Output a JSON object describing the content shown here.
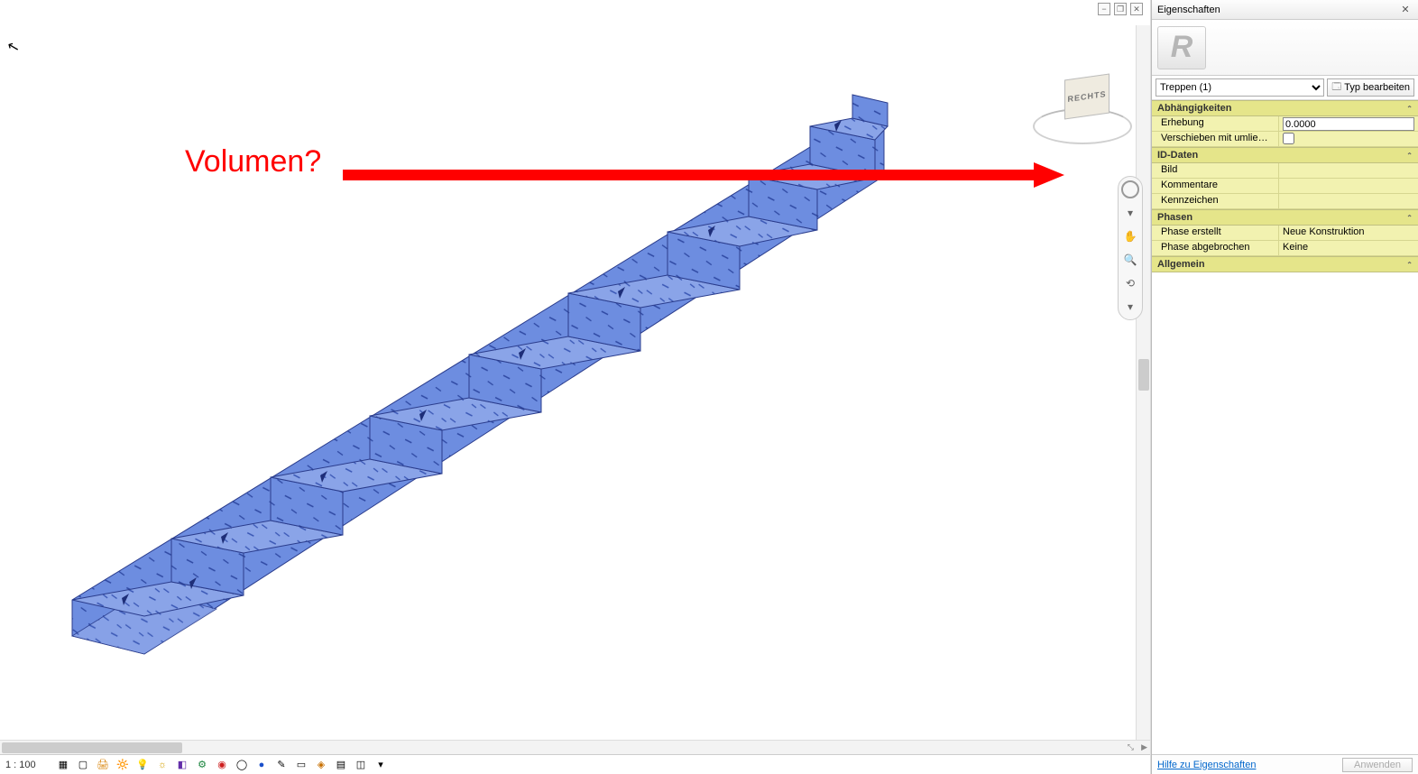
{
  "viewport": {
    "annotation_text": "Volumen?",
    "viewcube_face": "RECHTS",
    "scale": "1 : 100",
    "window_controls": {
      "min": "−",
      "restore": "❐",
      "close": "✕"
    }
  },
  "nav": {
    "wheel": "○",
    "pan": "✋",
    "zoom": "🔍",
    "orbit": "⟲",
    "down": "▾"
  },
  "status_icons": [
    "▦",
    "▢",
    "🖨",
    "🔆",
    "💡",
    "☼",
    "◧",
    "⚙",
    "◉",
    "◯",
    "●",
    "✎",
    "▭",
    "◈",
    "▤",
    "◫",
    "▾"
  ],
  "panel": {
    "title": "Eigenschaften",
    "type_logo": "R",
    "selector_value": "Treppen (1)",
    "edit_type_label": "Typ bearbeiten",
    "groups": [
      {
        "name": "Abhängigkeiten",
        "hl": true,
        "rows": [
          {
            "k": "Erhebung",
            "v": "0.0000",
            "type": "text",
            "hl": true
          },
          {
            "k": "Verschieben mit umlieg...",
            "v": "",
            "type": "check",
            "hl": true
          }
        ]
      },
      {
        "name": "ID-Daten",
        "hl": true,
        "rows": [
          {
            "k": "Bild",
            "v": "",
            "type": "plain",
            "hl": true
          },
          {
            "k": "Kommentare",
            "v": "",
            "type": "plain",
            "hl": true
          },
          {
            "k": "Kennzeichen",
            "v": "",
            "type": "plain",
            "hl": true
          }
        ]
      },
      {
        "name": "Phasen",
        "hl": true,
        "rows": [
          {
            "k": "Phase erstellt",
            "v": "Neue Konstruktion",
            "type": "plain",
            "hl": true
          },
          {
            "k": "Phase abgebrochen",
            "v": "Keine",
            "type": "plain",
            "hl": true
          }
        ]
      },
      {
        "name": "Allgemein",
        "hl": true,
        "rows": []
      }
    ],
    "help_link": "Hilfe zu Eigenschaften",
    "apply_label": "Anwenden"
  }
}
